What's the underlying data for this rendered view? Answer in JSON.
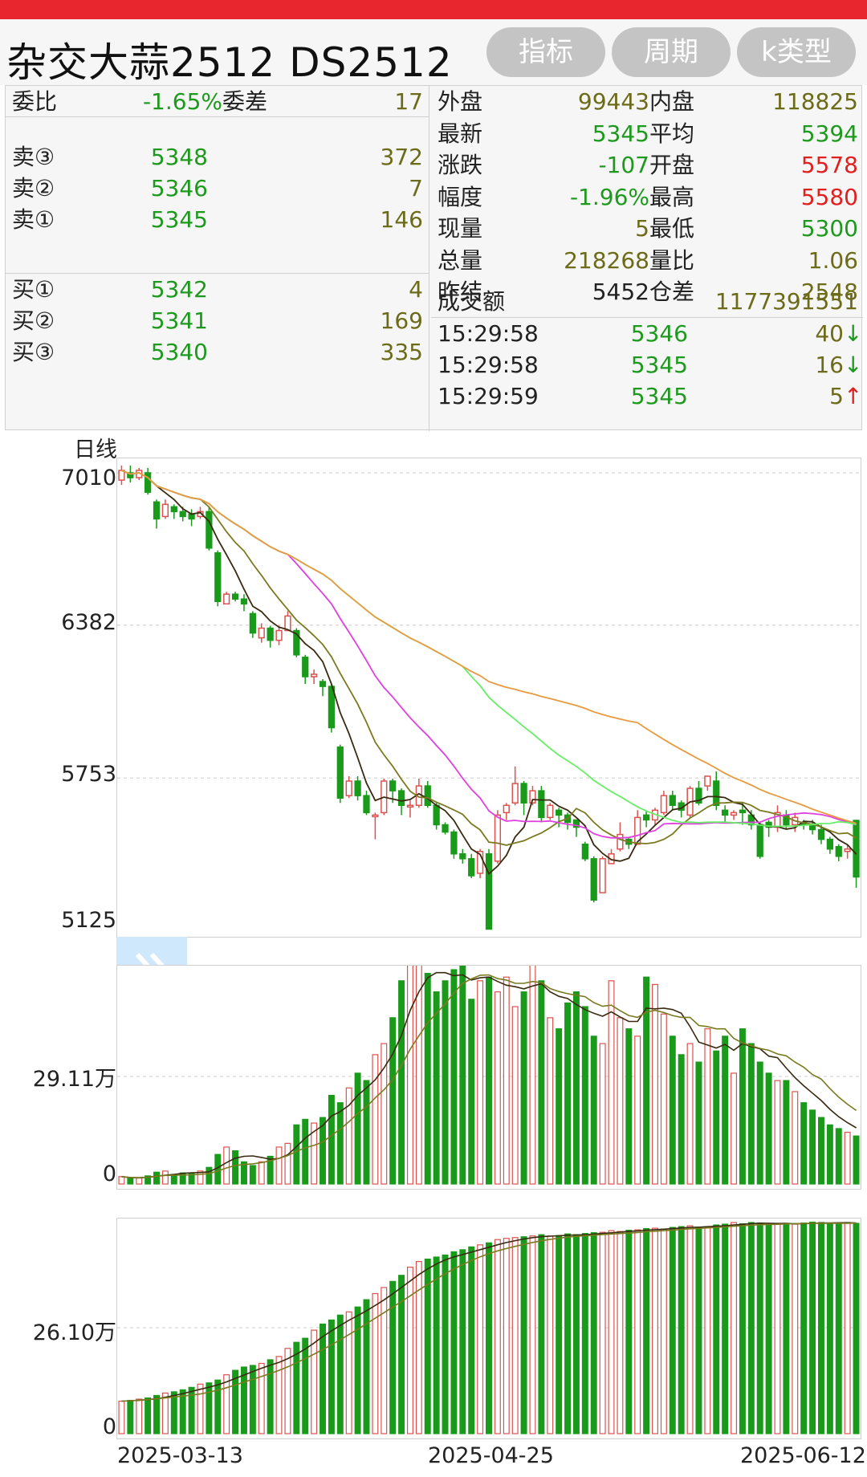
{
  "header": {
    "title": "杂交大蒜2512 DS2512",
    "buttons": [
      "指标",
      "周期",
      "k类型"
    ]
  },
  "quote": {
    "left_top": {
      "weibi_label": "委比",
      "weibi_value": "-1.65%",
      "weicha_label": "委差",
      "weicha_value": "17"
    },
    "asks": [
      {
        "label": "卖③",
        "price": "5348",
        "volume": "372"
      },
      {
        "label": "卖②",
        "price": "5346",
        "volume": "7"
      },
      {
        "label": "卖①",
        "price": "5345",
        "volume": "146"
      }
    ],
    "bids": [
      {
        "label": "买①",
        "price": "5342",
        "volume": "4"
      },
      {
        "label": "买②",
        "price": "5341",
        "volume": "169"
      },
      {
        "label": "买③",
        "price": "5340",
        "volume": "335"
      }
    ],
    "right_rows": [
      {
        "l1": "外盘",
        "v1": "99443",
        "l2": "内盘",
        "v2": "118825",
        "c1": "olive",
        "c2": "olive"
      },
      {
        "l1": "最新",
        "v1": "5345",
        "l2": "平均",
        "v2": "5394",
        "c1": "green",
        "c2": "green"
      },
      {
        "l1": "涨跌",
        "v1": "-107",
        "l2": "开盘",
        "v2": "5578",
        "c1": "green",
        "c2": "red"
      },
      {
        "l1": "幅度",
        "v1": "-1.96%",
        "l2": "最高",
        "v2": "5580",
        "c1": "green",
        "c2": "red"
      },
      {
        "l1": "现量",
        "v1": "5",
        "l2": "最低",
        "v2": "5300",
        "c1": "olive",
        "c2": "green"
      },
      {
        "l1": "总量",
        "v1": "218268",
        "l2": "量比",
        "v2": "1.06",
        "c1": "olive",
        "c2": "olive"
      },
      {
        "l1": "昨结",
        "v1": "5452",
        "l2": "仓差",
        "v2": "2548",
        "c1": "black",
        "c2": "olive"
      }
    ],
    "turnover_label": "成交额",
    "turnover_value": "1177391551",
    "ticks": [
      {
        "time": "15:29:58",
        "price": "5346",
        "volume": "40",
        "dir": "↓"
      },
      {
        "time": "15:29:58",
        "price": "5345",
        "volume": "16",
        "dir": "↓"
      },
      {
        "time": "15:29:59",
        "price": "5345",
        "volume": "5",
        "dir": "↑"
      }
    ]
  },
  "chart_data": [
    {
      "type": "candlestick",
      "title": "日线",
      "y_tick_labels": [
        "7010",
        "6382",
        "5753",
        "5125"
      ],
      "ylim": [
        5125,
        7010
      ],
      "grid": true,
      "x_tick_labels": [
        "2025-03-13",
        "2025-04-25",
        "2025-06-12"
      ],
      "colors": {
        "up": "#d9534f",
        "down": "#1a9a1a",
        "ma5": "#3a2a10",
        "ma10": "#7a7a20",
        "ma20": "#e040e0",
        "ma40": "#66ee66",
        "ma60": "#e89a40"
      },
      "candles": [
        [
          6980,
          7020,
          6960,
          7040
        ],
        [
          7010,
          6990,
          6970,
          7040
        ],
        [
          6990,
          7020,
          6980,
          7030
        ],
        [
          7010,
          6930,
          6920,
          7030
        ],
        [
          6890,
          6820,
          6780,
          6900
        ],
        [
          6830,
          6880,
          6820,
          6900
        ],
        [
          6870,
          6850,
          6820,
          6880
        ],
        [
          6850,
          6830,
          6810,
          6870
        ],
        [
          6840,
          6820,
          6790,
          6860
        ],
        [
          6830,
          6850,
          6820,
          6870
        ],
        [
          6850,
          6700,
          6690,
          6870
        ],
        [
          6680,
          6480,
          6460,
          6690
        ],
        [
          6470,
          6510,
          6470,
          6520
        ],
        [
          6510,
          6490,
          6480,
          6520
        ],
        [
          6490,
          6470,
          6440,
          6510
        ],
        [
          6430,
          6350,
          6330,
          6440
        ],
        [
          6330,
          6370,
          6310,
          6390
        ],
        [
          6370,
          6320,
          6290,
          6380
        ],
        [
          6320,
          6360,
          6300,
          6380
        ],
        [
          6360,
          6420,
          6360,
          6440
        ],
        [
          6360,
          6260,
          6250,
          6370
        ],
        [
          6250,
          6170,
          6140,
          6260
        ],
        [
          6170,
          6180,
          6140,
          6200
        ],
        [
          6150,
          6130,
          6090,
          6160
        ],
        [
          6130,
          5960,
          5940,
          6140
        ],
        [
          5880,
          5670,
          5650,
          5890
        ],
        [
          5680,
          5740,
          5670,
          5760
        ],
        [
          5740,
          5680,
          5660,
          5760
        ],
        [
          5680,
          5610,
          5600,
          5700
        ],
        [
          5600,
          5600,
          5500,
          5610
        ],
        [
          5610,
          5740,
          5600,
          5750
        ],
        [
          5740,
          5700,
          5650,
          5750
        ],
        [
          5700,
          5640,
          5600,
          5710
        ],
        [
          5640,
          5640,
          5590,
          5660
        ],
        [
          5640,
          5720,
          5630,
          5750
        ],
        [
          5720,
          5640,
          5630,
          5740
        ],
        [
          5640,
          5560,
          5540,
          5650
        ],
        [
          5560,
          5530,
          5520,
          5570
        ],
        [
          5530,
          5440,
          5420,
          5540
        ],
        [
          5440,
          5420,
          5400,
          5460
        ],
        [
          5420,
          5350,
          5340,
          5440
        ],
        [
          5360,
          5450,
          5340,
          5460
        ],
        [
          5440,
          5130,
          5130,
          5460
        ],
        [
          5410,
          5600,
          5400,
          5620
        ],
        [
          5610,
          5640,
          5580,
          5650
        ],
        [
          5650,
          5730,
          5640,
          5800
        ],
        [
          5730,
          5650,
          5600,
          5740
        ],
        [
          5650,
          5700,
          5640,
          5720
        ],
        [
          5700,
          5590,
          5570,
          5720
        ],
        [
          5590,
          5640,
          5580,
          5650
        ],
        [
          5620,
          5600,
          5550,
          5630
        ],
        [
          5600,
          5570,
          5540,
          5610
        ],
        [
          5580,
          5550,
          5510,
          5580
        ],
        [
          5480,
          5420,
          5410,
          5490
        ],
        [
          5420,
          5250,
          5240,
          5430
        ],
        [
          5280,
          5420,
          5280,
          5430
        ],
        [
          5400,
          5440,
          5400,
          5460
        ],
        [
          5460,
          5520,
          5450,
          5570
        ],
        [
          5500,
          5480,
          5460,
          5510
        ],
        [
          5480,
          5590,
          5480,
          5620
        ],
        [
          5600,
          5580,
          5550,
          5620
        ],
        [
          5580,
          5620,
          5560,
          5630
        ],
        [
          5610,
          5680,
          5600,
          5700
        ],
        [
          5680,
          5640,
          5620,
          5700
        ],
        [
          5650,
          5620,
          5590,
          5660
        ],
        [
          5600,
          5710,
          5590,
          5720
        ],
        [
          5710,
          5650,
          5640,
          5740
        ],
        [
          5720,
          5760,
          5700,
          5760
        ],
        [
          5740,
          5640,
          5620,
          5780
        ],
        [
          5620,
          5600,
          5570,
          5640
        ],
        [
          5600,
          5610,
          5580,
          5620
        ],
        [
          5620,
          5610,
          5560,
          5650
        ],
        [
          5600,
          5560,
          5540,
          5620
        ],
        [
          5560,
          5430,
          5420,
          5570
        ],
        [
          5570,
          5550,
          5510,
          5580
        ],
        [
          5550,
          5610,
          5530,
          5640
        ],
        [
          5600,
          5560,
          5540,
          5620
        ],
        [
          5560,
          5590,
          5530,
          5610
        ],
        [
          5570,
          5560,
          5540,
          5580
        ],
        [
          5560,
          5540,
          5520,
          5580
        ],
        [
          5540,
          5500,
          5480,
          5560
        ],
        [
          5500,
          5460,
          5440,
          5510
        ],
        [
          5470,
          5430,
          5410,
          5480
        ],
        [
          5450,
          5460,
          5420,
          5480
        ],
        [
          5578,
          5345,
          5300,
          5580
        ]
      ]
    },
    {
      "type": "bar",
      "title": "成交量",
      "y_tick_labels": [
        "29.11万",
        "0"
      ],
      "ylim": [
        0,
        58.22
      ],
      "unit": "万",
      "values": [
        2,
        1.5,
        1.6,
        2.2,
        3.2,
        3.5,
        2.5,
        3,
        3,
        3.5,
        4.5,
        8,
        10,
        9,
        6,
        5,
        6,
        7.5,
        10,
        11,
        16,
        17.5,
        16.5,
        18,
        24,
        22,
        26,
        30,
        28,
        35,
        38,
        45,
        55,
        62,
        60,
        57,
        52,
        55,
        58,
        61,
        50,
        55,
        56,
        52,
        56,
        48,
        52,
        60,
        55,
        45,
        42,
        49,
        52,
        48,
        40,
        38,
        55,
        45,
        42,
        40,
        56,
        54,
        46,
        40,
        35,
        38,
        33,
        42,
        36,
        40,
        30,
        42,
        38,
        33,
        30,
        28,
        28,
        25,
        22,
        20,
        18,
        16,
        15,
        14,
        13
      ]
    },
    {
      "type": "bar",
      "title": "持仓量",
      "y_tick_labels": [
        "26.10万",
        "0"
      ],
      "ylim": [
        0,
        52.2
      ],
      "unit": "万",
      "values": [
        8,
        8.2,
        8.5,
        8.8,
        9.4,
        10,
        10.3,
        10.8,
        11.4,
        12.2,
        12.5,
        13.2,
        14.5,
        15.6,
        16.4,
        16.8,
        17.3,
        18.2,
        19,
        21,
        22.5,
        23.5,
        25.5,
        27,
        28,
        29.2,
        30,
        31.2,
        33,
        34.5,
        36,
        37.5,
        39,
        41,
        42.4,
        43,
        43.5,
        44,
        44.8,
        45.3,
        46,
        46.5,
        47,
        47.8,
        48.1,
        48.3,
        48.5,
        48.7,
        49,
        48.7,
        48.8,
        49.2,
        49,
        49.3,
        49.5,
        49.6,
        50,
        49.8,
        50.1,
        50.2,
        50.5,
        50.6,
        50.4,
        50.8,
        51,
        51.2,
        50.9,
        51,
        51.4,
        51.6,
        52,
        51.7,
        52,
        51.9,
        51.5,
        51.7,
        51.8,
        51.6,
        51.9,
        52.1,
        52,
        51.8,
        51.9,
        52,
        51.8
      ]
    }
  ]
}
